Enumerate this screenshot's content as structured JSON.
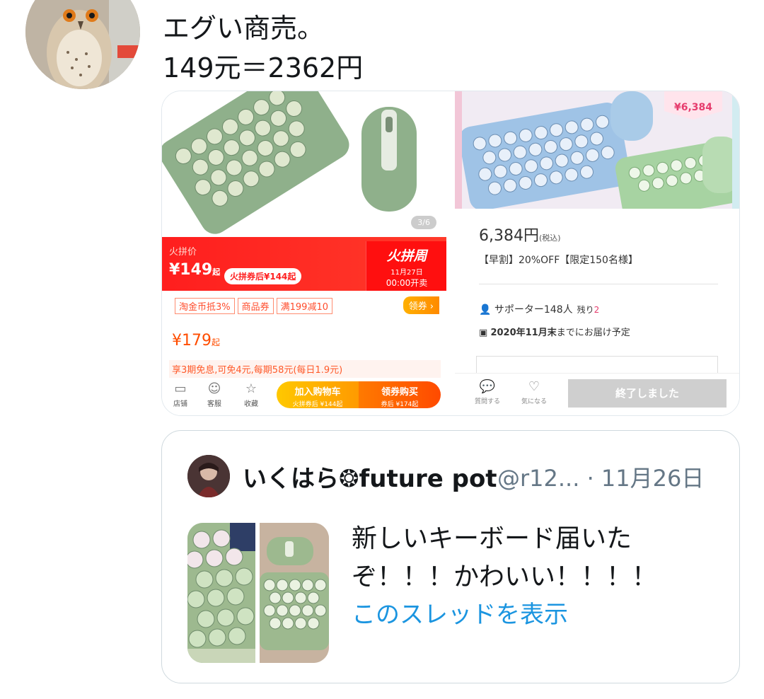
{
  "tweet": {
    "line_partial": "",
    "line1": "エグい商売。",
    "line2": "149元＝2362円"
  },
  "taobao": {
    "page_indicator": "3/6",
    "flash_label": "火拼价",
    "flash_price": "¥149",
    "flash_suffix": "起",
    "coupon": "火拼券后¥144起",
    "week_title": "火拼周",
    "week_date": "11月27日",
    "week_time": "00:00开卖",
    "tags": [
      "淘金币抵3%",
      "商品券",
      "满199减10"
    ],
    "claim": "领券",
    "price": "¥179",
    "price_suffix": "起",
    "installment": "享3期免息,可免4元,每期58元(每日1.9元)",
    "icons": [
      {
        "glyph": "▭",
        "label": "店铺"
      },
      {
        "glyph": "☺",
        "label": "客服"
      },
      {
        "glyph": "☆",
        "label": "收藏"
      }
    ],
    "cart_main": "加入购物车",
    "cart_sub": "火拼券后 ¥144起",
    "buy_main": "领券购买",
    "buy_sub": "券后 ¥174起"
  },
  "makuake": {
    "badge": "¥6,384",
    "price": "6,384円",
    "tax": "(税込)",
    "early": "【早割】20%OFF【限定150名様】",
    "supporters": "サポーター148人",
    "remaining_label": "残り",
    "remaining": "2",
    "delivery_bold": "2020年11月末",
    "delivery_rest": "までにお届け予定",
    "icon_question": "質問する",
    "icon_fav": "気になる",
    "ended": "終了しました"
  },
  "quote": {
    "name": "いくはら❂future pot",
    "handle": "@r12... · 11月26日",
    "text": "新しいキーボード届いたぞ！！！かわいい！！！！",
    "link": "このスレッドを表示"
  },
  "colors": {
    "link": "#1b95e0",
    "taobao_red": "#ff1e1e",
    "makuake_pink": "#e63c6d"
  }
}
